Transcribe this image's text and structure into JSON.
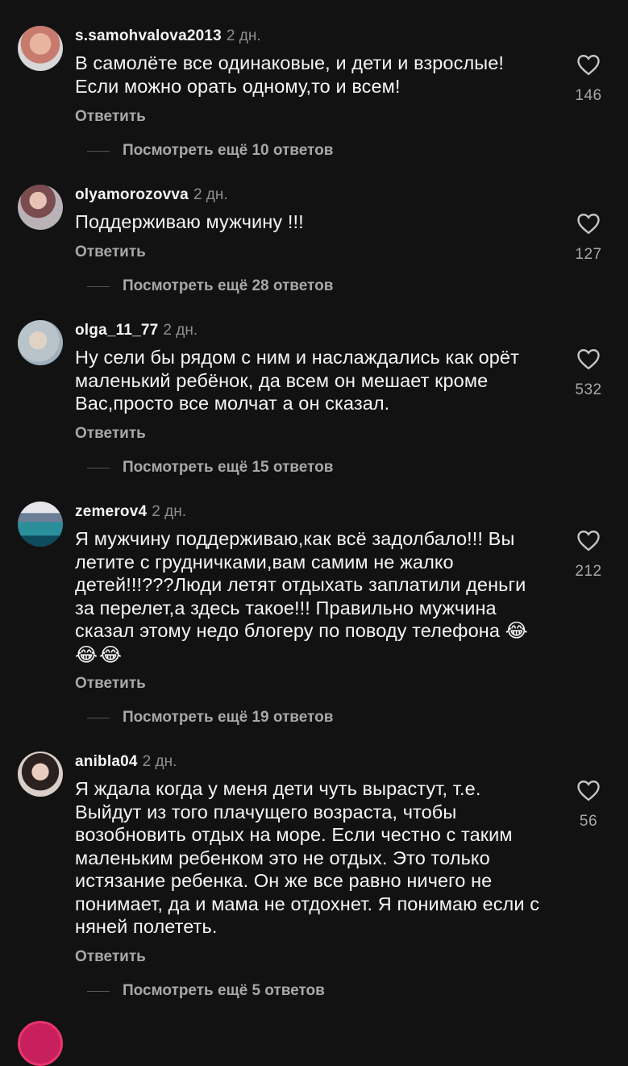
{
  "comments": [
    {
      "username": "s.samohvalova2013",
      "time": "2 дн.",
      "text": "В самолёте все одинаковые, и дети и взрослые! Если можно орать одному,то и всем!",
      "emoji": "",
      "reply_label": "Ответить",
      "view_replies": "Посмотреть ещё 10 ответов",
      "likes": "146",
      "avatar_color": "#c77a6e"
    },
    {
      "username": "olyamorozovva",
      "time": "2 дн.",
      "text": "Поддерживаю мужчину !!!",
      "emoji": "",
      "reply_label": "Ответить",
      "view_replies": "Посмотреть ещё 28 ответов",
      "likes": "127",
      "avatar_color": "#8a5a5f"
    },
    {
      "username": "olga_11_77",
      "time": "2 дн.",
      "text": "Ну сели бы рядом с ним и наслаждались как орёт маленький ребёнок, да всем он мешает кроме Вас,просто все молчат а он сказал.",
      "emoji": "",
      "reply_label": "Ответить",
      "view_replies": "Посмотреть ещё 15 ответов",
      "likes": "532",
      "avatar_color": "#b8c4c9"
    },
    {
      "username": "zemerov4",
      "time": "2 дн.",
      "text": "Я мужчину поддерживаю,как всё задолбало!!! Вы летите с грудничками,вам самим не жалко детей!!!???Люди летят отдыхать заплатили деньги за перелет,а здесь такое!!! Правильно мужчина сказал этому недо блогеру по поводу телефона ",
      "emoji": "😂😂😂",
      "reply_label": "Ответить",
      "view_replies": "Посмотреть ещё 19 ответов",
      "likes": "212",
      "avatar_color": "#3d6f8c"
    },
    {
      "username": "anibla04",
      "time": "2 дн.",
      "text": "Я ждала когда у меня дети чуть вырастут, т.е. Выйдут из того плачущего возраста, чтобы возобновить отдых на море. Если честно с таким маленьким ребенком это не отдых. Это только истязание ребенка. Он же все равно ничего не понимает, да и мама не отдохнет. Я понимаю если с няней полететь.",
      "emoji": "",
      "reply_label": "Ответить",
      "view_replies": "Посмотреть ещё 5 ответов",
      "likes": "56",
      "avatar_color": "#d9cfc8"
    }
  ],
  "colors": {
    "background": "#121212",
    "text": "#f5f5f5",
    "secondary": "#a8a8a8"
  }
}
